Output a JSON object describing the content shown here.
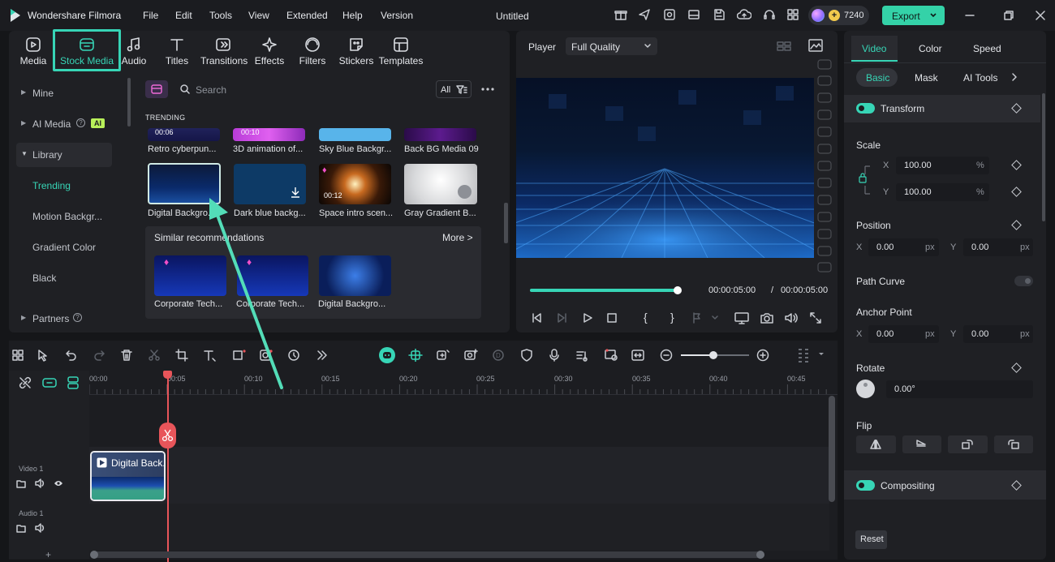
{
  "app": {
    "name": "Wondershare Filmora",
    "doc_title": "Untitled",
    "credits": "7240",
    "export_label": "Export"
  },
  "menu": [
    "File",
    "Edit",
    "Tools",
    "View",
    "Extended",
    "Help",
    "Version"
  ],
  "toolbar": {
    "media": "Media",
    "stock": "Stock Media",
    "audio": "Audio",
    "titles": "Titles",
    "transitions": "Transitions",
    "effects": "Effects",
    "filters": "Filters",
    "stickers": "Stickers",
    "templates": "Templates"
  },
  "sidebar": {
    "mine": "Mine",
    "ai_media": "AI Media",
    "ai_badge": "AI",
    "library": "Library",
    "trending": "Trending",
    "motion": "Motion Backgr...",
    "gradient": "Gradient Color",
    "black": "Black",
    "partners": "Partners"
  },
  "browser": {
    "search_placeholder": "Search",
    "filter_label": "All",
    "section": "TRENDING",
    "row1": [
      {
        "title": "Retro cyberpun...",
        "dur": "00:06"
      },
      {
        "title": "3D animation of...",
        "dur": "00:10"
      },
      {
        "title": "Sky Blue Backgr...",
        "dur": ""
      },
      {
        "title": "Back BG Media 09",
        "dur": ""
      }
    ],
    "row2": [
      {
        "title": "Digital Backgro...",
        "dur": ""
      },
      {
        "title": "Dark blue backg...",
        "dur": ""
      },
      {
        "title": "Space intro scen...",
        "dur": "00:12"
      },
      {
        "title": "Gray Gradient B...",
        "dur": ""
      }
    ],
    "similar_title": "Similar recommendations",
    "more_label": "More >",
    "similar": [
      "Corporate Tech...",
      "Corporate Tech...",
      "Digital Backgro..."
    ]
  },
  "player": {
    "label": "Player",
    "quality": "Full Quality",
    "current": "00:00:05:00",
    "sep": "/",
    "total": "00:00:05:00",
    "progress": 1.0
  },
  "timeline": {
    "ruler": [
      "00:00",
      "00:05",
      "00:10",
      "00:15",
      "00:20",
      "00:25",
      "00:30",
      "00:35",
      "00:40",
      "00:45"
    ],
    "video_track": "Video 1",
    "audio_track": "Audio 1",
    "clip_title": "Digital Back...",
    "add": "+"
  },
  "props": {
    "tabs": [
      "Video",
      "Color",
      "Speed"
    ],
    "subtabs": [
      "Basic",
      "Mask",
      "AI Tools"
    ],
    "transform": "Transform",
    "scale": "Scale",
    "scale_x": "100.00",
    "scale_y": "100.00",
    "pct": "%",
    "position": "Position",
    "pos_x": "0.00",
    "pos_y": "0.00",
    "px": "px",
    "path_curve": "Path Curve",
    "anchor": "Anchor Point",
    "anc_x": "0.00",
    "anc_y": "0.00",
    "rotate": "Rotate",
    "rot_val": "0.00°",
    "flip": "Flip",
    "compositing": "Compositing",
    "reset": "Reset",
    "x": "X",
    "y": "Y"
  },
  "colors": {
    "accent": "#37d5b6",
    "export_bg": "#34d2a8",
    "playhead": "#e8555a"
  }
}
